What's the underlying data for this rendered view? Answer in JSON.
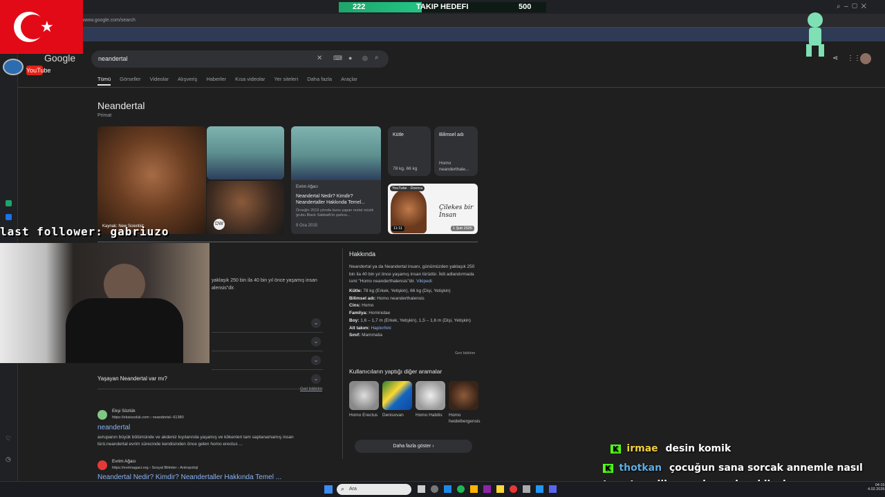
{
  "stream": {
    "goal_current": "222",
    "goal_label": "TAKIP HEDEFI",
    "goal_target": "500",
    "last_follower": "last follower: gabriuzo"
  },
  "browser": {
    "url": "www.google.com/search",
    "logo": "Google",
    "yt_label": "YouTube"
  },
  "search": {
    "query": "neandertal",
    "tabs": [
      "Tümü",
      "Görseller",
      "Videolar",
      "Alışveriş",
      "Haberler",
      "Kısa videolar",
      "Yer siteleri",
      "Daha fazla",
      "Araçlar"
    ]
  },
  "kp": {
    "title": "Neandertal",
    "subtitle": "Primat",
    "img_caption": "Kaynak: New Scientist",
    "card1": {
      "source": "Evrim Ağacı",
      "title": "Neandertal Nedir? Kimdir? Neandertaller Hakkında Temel...",
      "snippet": "Örneğin 2019 yılında bunu yapan metal müzik grubu Black Sabbath'in şarkısı...",
      "date": "9 Oca 2015"
    },
    "kutle": {
      "label": "Kütle",
      "value": "78 kg, 66 kg"
    },
    "bilimsel": {
      "label": "Bilimsel adı",
      "value": "Homo neanderthale..."
    },
    "video": {
      "source": "YouTube · Doorca",
      "duration": "11:11",
      "hand": "Çilekes bir Insan",
      "date": "1 Şub 2025"
    },
    "hakkinda_title": "Hakkında",
    "hakkinda_text": "Neandertal ya da Neandertal insanı, günümüzden yaklaşık 250 bin ila 40 bin yıl önce yaşamış insan türüdür. İkili adlandırmada ismi \"Homo neanderthalensis\"dir.",
    "wiki": "Vikipedi",
    "facts": [
      {
        "k": "Kütle:",
        "v": "78 kg (Erkek, Yetişkin), 66 kg (Dişi, Yetişkin)"
      },
      {
        "k": "Bilimsel adı:",
        "v": "Homo neanderthalensis"
      },
      {
        "k": "Cins:",
        "v": "Homo"
      },
      {
        "k": "Familya:",
        "v": "Hominidae"
      },
      {
        "k": "Boy:",
        "v": "1,6 – 1,7 m (Erkek, Yetişkin), 1,5 – 1,6 m (Dişi, Yetişkin)"
      },
      {
        "k": "Alt takım:",
        "v": "Haplorhini"
      },
      {
        "k": "Sınıf:",
        "v": "Mammalia"
      }
    ],
    "feedback": "Geri bildirim",
    "related_title": "Kullanıcıların yaptığı diğer aramalar",
    "related": [
      "Homo Erectus",
      "Denisovan",
      "Homo Habilis",
      "Homo heidelbergensis"
    ],
    "more": "Daha fazla göster",
    "left_snip": "yaklaşık 250 bin ila 40 bin yıl önce yaşamış insan",
    "left_snip2": "alensis\"dir.",
    "faq": "Yaşayan Neandertal var mı?"
  },
  "results": [
    {
      "site": "Ekşi Sözlük",
      "url": "https://eksisozluk.com › neandertal--61380",
      "title": "neandertal",
      "snippet": "avrupanın büyük bölümünde ve akdeniz kıyılarında yaşamış ve kökenleri tam saptanamamış insan türü.neandertal evrim sürecinde kendisinden önce gelen homo erectus ..."
    },
    {
      "site": "Evrim Ağacı",
      "url": "https://evrimagaci.org › Sosyal Bilimler › Antropoloji",
      "title": "Neandertal Nedir? Kimdir? Neandertaller Hakkında Temel ..."
    }
  ],
  "chat": [
    {
      "user": "irmae",
      "msg": "desin komik"
    },
    {
      "user": "thotkan",
      "msg": "çocuğun sana sorcak annemle nasıl tanıştınız ilk mesajı nasıl açıklicaksınız"
    }
  ],
  "taskbar": {
    "search": "Ara",
    "time": "04:15",
    "date": "4.02.2026"
  },
  "colors": {
    "accent": "#8ab4f8",
    "goal": "#22c484",
    "flag": "#e30a17",
    "chat_user": "#53fc18"
  }
}
